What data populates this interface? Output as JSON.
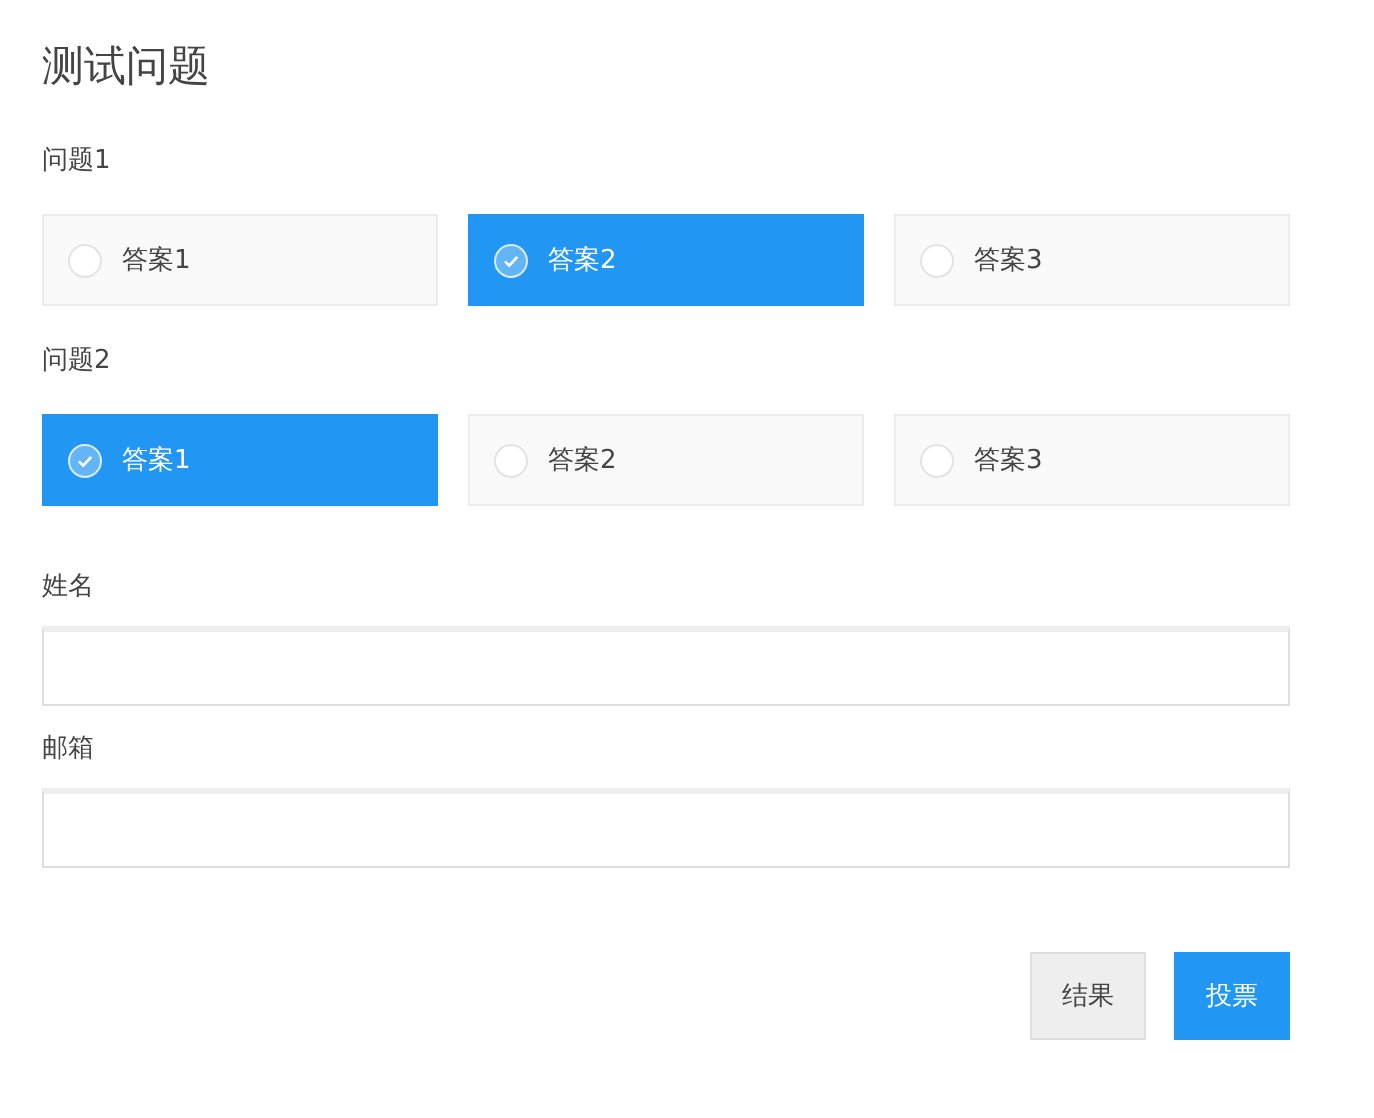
{
  "title": "测试问题",
  "questions": [
    {
      "label": "问题1",
      "options": [
        {
          "label": "答案1",
          "selected": false
        },
        {
          "label": "答案2",
          "selected": true
        },
        {
          "label": "答案3",
          "selected": false
        }
      ]
    },
    {
      "label": "问题2",
      "options": [
        {
          "label": "答案1",
          "selected": true
        },
        {
          "label": "答案2",
          "selected": false
        },
        {
          "label": "答案3",
          "selected": false
        }
      ]
    }
  ],
  "fields": [
    {
      "label": "姓名"
    },
    {
      "label": "邮箱"
    }
  ],
  "buttons": [
    {
      "label": "结果",
      "kind": "secondary"
    },
    {
      "label": "投票",
      "kind": "primary"
    }
  ]
}
